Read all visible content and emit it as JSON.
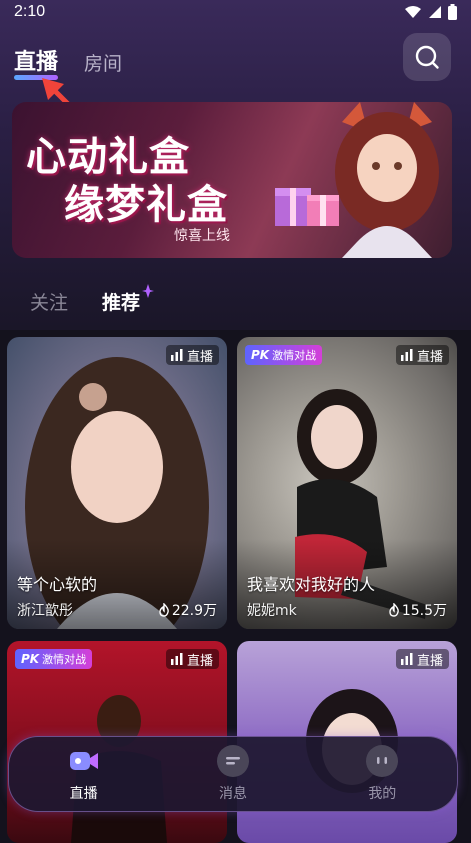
{
  "status": {
    "time": "2:10"
  },
  "header": {
    "tabs": [
      {
        "label": "直播"
      },
      {
        "label": "房间"
      }
    ],
    "search_icon": "search-icon"
  },
  "banner": {
    "title_line1": "心动礼盒",
    "title_line2": "缘梦礼盒",
    "subtitle": "惊喜上线"
  },
  "categories": [
    {
      "label": "关注"
    },
    {
      "label": "推荐"
    }
  ],
  "cards": [
    {
      "caption": "等个心软的",
      "name": "浙江歆彤",
      "heat": "22.9万",
      "badge": "直播"
    },
    {
      "caption": "我喜欢对我好的人",
      "name": "妮妮mk",
      "heat": "15.5万",
      "badge": "直播",
      "pk": "PK",
      "pk_text": "激情对战"
    },
    {
      "badge": "直播",
      "pk": "PK",
      "pk_text": "激情对战"
    },
    {
      "badge": "直播"
    }
  ],
  "nav": [
    {
      "label": "直播",
      "icon": "live-video-icon"
    },
    {
      "label": "消息",
      "icon": "message-icon"
    },
    {
      "label": "我的",
      "icon": "profile-icon"
    }
  ],
  "colors": {
    "accent_gradient_start": "#5aa7ff",
    "accent_gradient_end": "#b061ff",
    "pk_gradient_start": "#5e64ff",
    "pk_gradient_end": "#d43fd8"
  }
}
